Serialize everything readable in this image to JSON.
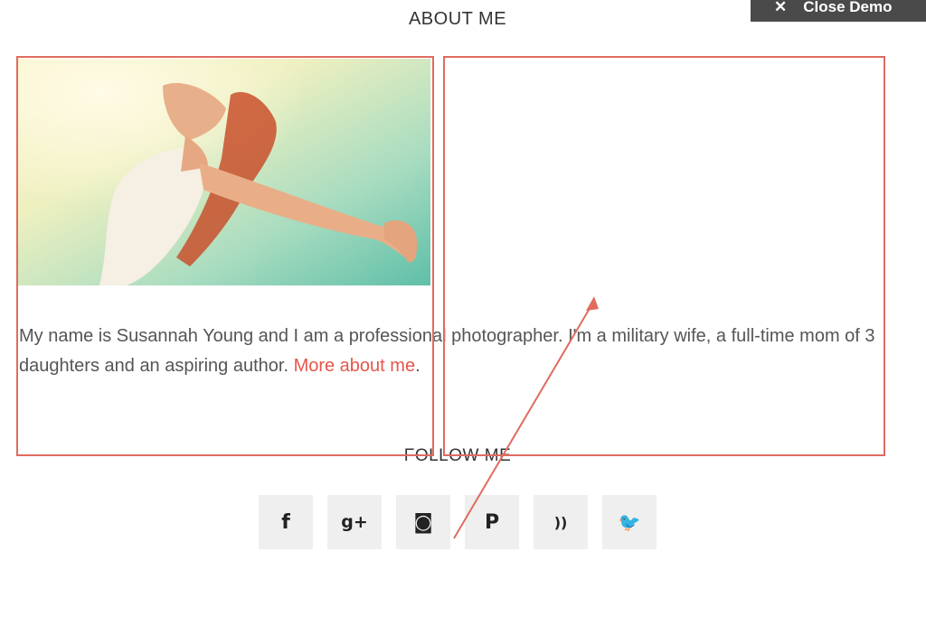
{
  "close_demo": {
    "icon": "close-icon",
    "label": "Close Demo"
  },
  "about": {
    "title": "ABOUT ME"
  },
  "photo": {
    "alt": "woman-arms-outstretched-in-sunlight"
  },
  "bio": {
    "text": "My name is Susannah Young and I am a professional photographer. I'm a military wife, a full-time mom of 3 daughters and an aspiring author. ",
    "link_text": "More about me",
    "suffix": "."
  },
  "follow": {
    "title": "FOLLOW ME",
    "icons": [
      {
        "name": "facebook-icon",
        "glyph": "f"
      },
      {
        "name": "google-plus-icon",
        "glyph": "g+"
      },
      {
        "name": "instagram-icon",
        "glyph": "◙"
      },
      {
        "name": "pinterest-icon",
        "glyph": "P"
      },
      {
        "name": "rss-icon",
        "glyph": "))"
      },
      {
        "name": "twitter-icon",
        "glyph": "🐦"
      }
    ]
  },
  "colors": {
    "accent": "#e4574a",
    "annotation": "#e06b5f",
    "social_bg": "#efefef"
  }
}
